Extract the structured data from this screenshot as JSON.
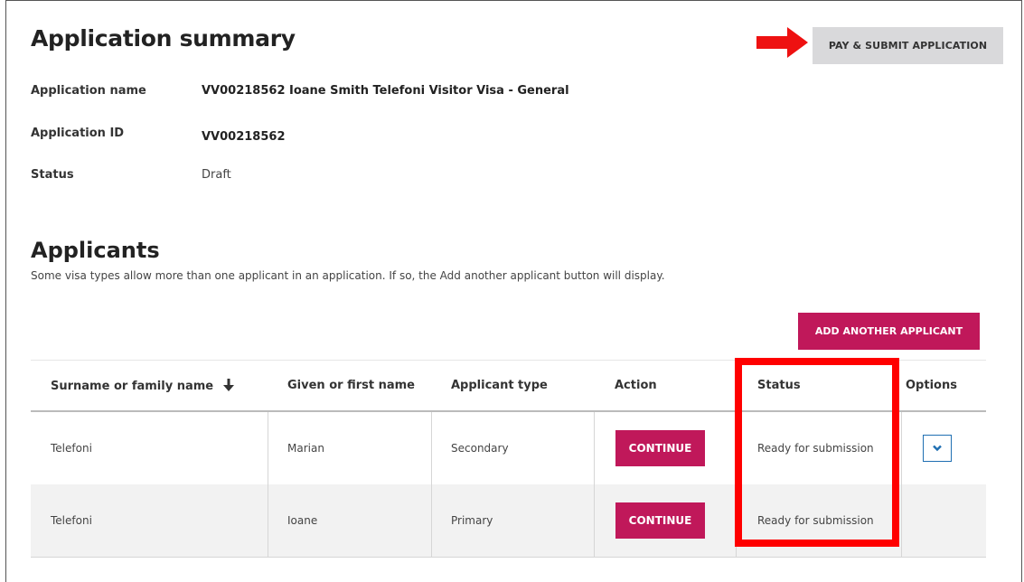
{
  "summary": {
    "title": "Application summary",
    "fields": [
      {
        "label": "Application name",
        "value": "VV00218562 Ioane Smith Telefoni Visitor Visa - General"
      },
      {
        "label": "Application ID",
        "value": "VV00218562"
      },
      {
        "label": "Status",
        "value": "Draft"
      }
    ],
    "pay_button": "PAY & SUBMIT APPLICATION"
  },
  "applicants": {
    "title": "Applicants",
    "description": "Some visa types allow more than one applicant in an application. If so, the Add another applicant button will display.",
    "add_button": "ADD ANOTHER APPLICANT",
    "columns": [
      "Surname or family name",
      "Given or first name",
      "Applicant type",
      "Action",
      "Status",
      "Options"
    ],
    "sort_icon": "arrow-down-icon",
    "rows": [
      {
        "surname": "Telefoni",
        "given": "Marian",
        "type": "Secondary",
        "action": "CONTINUE",
        "status": "Ready for submission",
        "has_options": true
      },
      {
        "surname": "Telefoni",
        "given": "Ioane",
        "type": "Primary",
        "action": "CONTINUE",
        "status": "Ready for submission",
        "has_options": false
      }
    ]
  },
  "colors": {
    "brand": "#c0185a",
    "annotation": "#ff0000",
    "pay_button_bg": "#d9d9db",
    "options_border": "#1f6fb2"
  }
}
